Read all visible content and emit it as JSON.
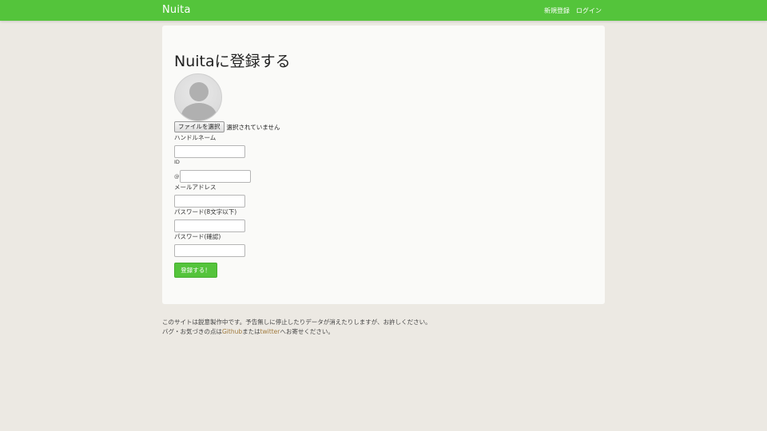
{
  "navbar": {
    "brand": "Nuita",
    "signup_label": "新規登録",
    "login_label": "ログイン",
    "color": "#54c43b"
  },
  "form": {
    "title": "Nuitaに登録する",
    "file_button": "ファイルを選択",
    "file_status": "選択されていません",
    "handle_label": "ハンドルネーム",
    "id_label": "ID",
    "id_prefix": "@",
    "email_label": "メールアドレス",
    "password_label": "パスワード(8文字以下)",
    "password_confirm_label": "パスワード(確認)",
    "submit_label": "登録する！"
  },
  "footer": {
    "line1": "このサイトは鋭意製作中です。予告無しに停止したりデータが消えたりしますが、お許しください。",
    "line2_prefix": "バグ・お気づきの点は",
    "github_link": "Github",
    "line2_middle": "または",
    "twitter_link": "twitter",
    "line2_suffix": "へお寄せください。"
  }
}
